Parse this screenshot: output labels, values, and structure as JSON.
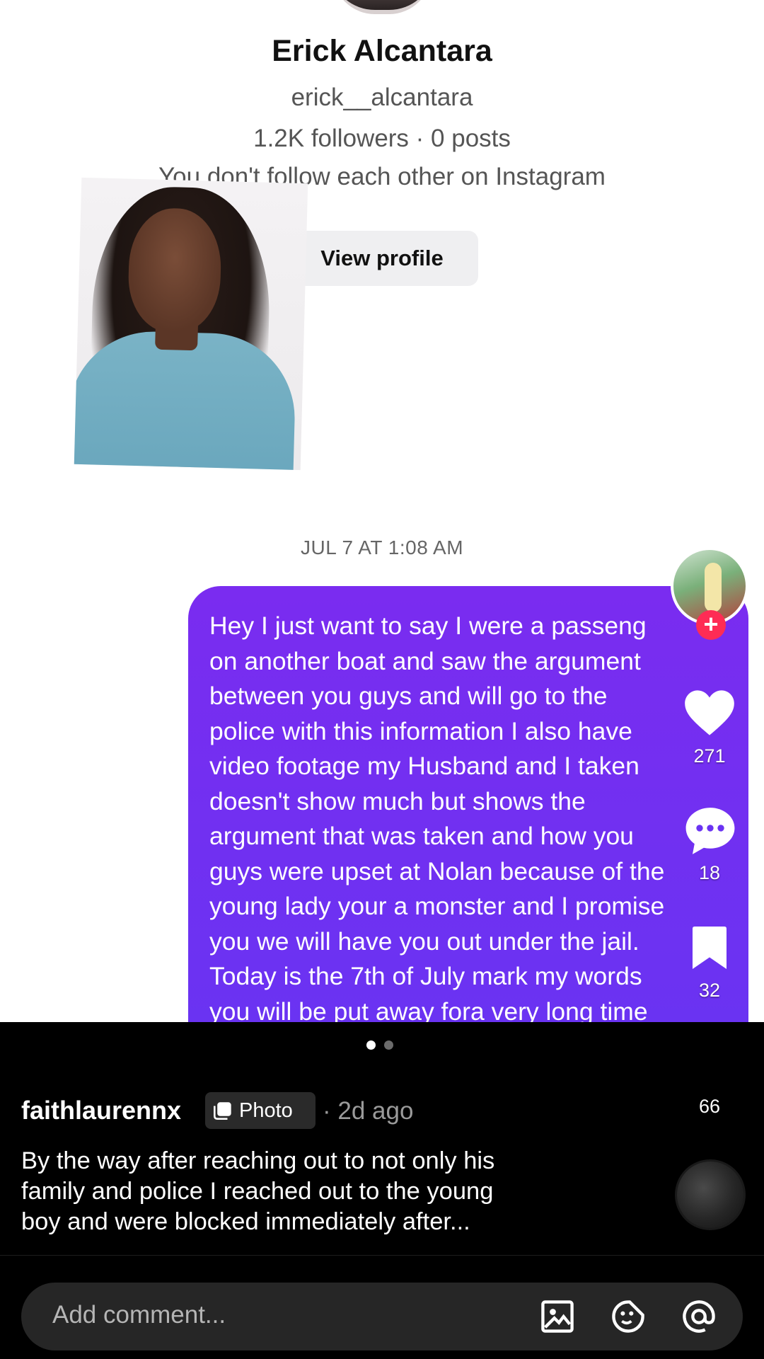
{
  "profile": {
    "name": "Erick Alcantara",
    "handle": "erick__alcantara",
    "stats": "1.2K followers · 0 posts",
    "relationship": "You don't follow each other on Instagram",
    "view_profile_label": "View profile"
  },
  "chat": {
    "timestamp": "JUL 7 AT 1:08 AM",
    "message": "Hey I just want to say I were a passeng\non another boat and saw the argument\nbetween you guys and will go to the\npolice with this information I also have\nvideo footage my Husband and I taken\ndoesn't show much but shows the\nargument that was taken and how you\nguys were upset at Nolan because of the\nyoung lady your a monster and I promise\nyou we will have you out under the jail.\nToday is the 7th of July mark my words\nyou will be put away fora very long time"
  },
  "actions": {
    "likes": "271",
    "comments": "18",
    "saves": "32",
    "shares": "66"
  },
  "post": {
    "username": "faithlaurennx",
    "type_badge": "Photo",
    "time": "· 2d ago",
    "caption": "By the way after reaching out to not only his\nfamily and police I reached out to the young\nboy and were blocked immediately after..."
  },
  "carousel": {
    "pages": 2,
    "current": 1
  },
  "comment_input": {
    "placeholder": "Add comment..."
  },
  "colors": {
    "bubble": "#6f30f0",
    "like_accent": "#fe2c55",
    "panel": "#000000"
  },
  "icons": [
    "heart-icon",
    "comment-icon",
    "bookmark-icon",
    "share-icon",
    "image-icon",
    "emoji-icon",
    "mention-icon",
    "plus-icon"
  ]
}
